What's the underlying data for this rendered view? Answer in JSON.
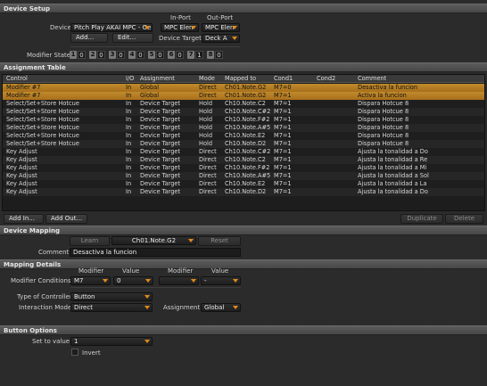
{
  "device_setup": {
    "header": "Device Setup",
    "device_label": "Device",
    "device_value": "Pitch Play AKAI MPC - Ge",
    "in_port_label": "In-Port",
    "in_port_value": "MPC Elen",
    "out_port_label": "Out-Port",
    "out_port_value": "MPC Elen",
    "add_label": "Add...",
    "edit_label": "Edit...",
    "device_target_label": "Device Target",
    "device_target_value": "Deck A",
    "modifier_state_label": "Modifier State",
    "modifier_states": [
      {
        "num": "1",
        "val": "0"
      },
      {
        "num": "2",
        "val": "0"
      },
      {
        "num": "3",
        "val": "0"
      },
      {
        "num": "4",
        "val": "0"
      },
      {
        "num": "5",
        "val": "0"
      },
      {
        "num": "6",
        "val": "0"
      },
      {
        "num": "7",
        "val": "1"
      },
      {
        "num": "8",
        "val": "0"
      }
    ]
  },
  "assignment_table": {
    "header": "Assignment Table",
    "columns": [
      "Control",
      "I/O",
      "Assignment",
      "Mode",
      "Mapped to",
      "Cond1",
      "Cond2",
      "Comment"
    ],
    "rows": [
      {
        "control": "Modifier #7",
        "io": "In",
        "assignment": "Global",
        "mode": "Direct",
        "mapped": "Ch01.Note.G2",
        "cond1": "M7=0",
        "cond2": "",
        "comment": "Desactiva la funcion",
        "selected": true
      },
      {
        "control": "Modifier #7",
        "io": "In",
        "assignment": "Global",
        "mode": "Direct",
        "mapped": "Ch01.Note.G2",
        "cond1": "M7=1",
        "cond2": "",
        "comment": "Activa la funcion",
        "selected": true
      },
      {
        "control": "Select/Set+Store Hotcue",
        "io": "In",
        "assignment": "Device Target",
        "mode": "Hold",
        "mapped": "Ch10.Note.C2",
        "cond1": "M7=1",
        "cond2": "",
        "comment": "Dispara Hotcue 8",
        "selected": false
      },
      {
        "control": "Select/Set+Store Hotcue",
        "io": "In",
        "assignment": "Device Target",
        "mode": "Hold",
        "mapped": "Ch10.Note.C#2",
        "cond1": "M7=1",
        "cond2": "",
        "comment": "Dispara Hotcue 8",
        "selected": false
      },
      {
        "control": "Select/Set+Store Hotcue",
        "io": "In",
        "assignment": "Device Target",
        "mode": "Hold",
        "mapped": "Ch10.Note.F#2",
        "cond1": "M7=1",
        "cond2": "",
        "comment": "Dispara Hotcue 8",
        "selected": false
      },
      {
        "control": "Select/Set+Store Hotcue",
        "io": "In",
        "assignment": "Device Target",
        "mode": "Hold",
        "mapped": "Ch10.Note.A#5",
        "cond1": "M7=1",
        "cond2": "",
        "comment": "Dispara Hotcue 8",
        "selected": false
      },
      {
        "control": "Select/Set+Store Hotcue",
        "io": "In",
        "assignment": "Device Target",
        "mode": "Hold",
        "mapped": "Ch10.Note.E2",
        "cond1": "M7=1",
        "cond2": "",
        "comment": "Dispara Hotcue 8",
        "selected": false
      },
      {
        "control": "Select/Set+Store Hotcue",
        "io": "In",
        "assignment": "Device Target",
        "mode": "Hold",
        "mapped": "Ch10.Note.D2",
        "cond1": "M7=1",
        "cond2": "",
        "comment": "Dispara Hotcue 8",
        "selected": false
      },
      {
        "control": "Key Adjust",
        "io": "In",
        "assignment": "Device Target",
        "mode": "Direct",
        "mapped": "Ch10.Note.C#2",
        "cond1": "M7=1",
        "cond2": "",
        "comment": "Ajusta la tonalidad a Do",
        "selected": false
      },
      {
        "control": "Key Adjust",
        "io": "In",
        "assignment": "Device Target",
        "mode": "Direct",
        "mapped": "Ch10.Note.C2",
        "cond1": "M7=1",
        "cond2": "",
        "comment": "Ajusta la tonalidad a Re",
        "selected": false
      },
      {
        "control": "Key Adjust",
        "io": "In",
        "assignment": "Device Target",
        "mode": "Direct",
        "mapped": "Ch10.Note.F#2",
        "cond1": "M7=1",
        "cond2": "",
        "comment": "Ajusta la tonalidad a Mi",
        "selected": false
      },
      {
        "control": "Key Adjust",
        "io": "In",
        "assignment": "Device Target",
        "mode": "Direct",
        "mapped": "Ch10.Note.A#5",
        "cond1": "M7=1",
        "cond2": "",
        "comment": "Ajusta la tonalidad a Sol",
        "selected": false
      },
      {
        "control": "Key Adjust",
        "io": "In",
        "assignment": "Device Target",
        "mode": "Direct",
        "mapped": "Ch10.Note.E2",
        "cond1": "M7=1",
        "cond2": "",
        "comment": "Ajusta la tonalidad a La",
        "selected": false
      },
      {
        "control": "Key Adjust",
        "io": "In",
        "assignment": "Device Target",
        "mode": "Direct",
        "mapped": "Ch10.Note.D2",
        "cond1": "M7=1",
        "cond2": "",
        "comment": "Ajusta la tonalidad a Do",
        "selected": false
      }
    ],
    "add_in_label": "Add In...",
    "add_out_label": "Add Out...",
    "duplicate_label": "Duplicate",
    "delete_label": "Delete"
  },
  "device_mapping": {
    "header": "Device Mapping",
    "learn_label": "Learn",
    "mapped_value": "Ch01.Note.G2",
    "reset_label": "Reset",
    "comment_label": "Comment",
    "comment_value": "Desactiva la funcion"
  },
  "mapping_details": {
    "header": "Mapping Details",
    "modifier_col1": "Modifier",
    "value_col1": "Value",
    "modifier_col2": "Modifier",
    "value_col2": "Value",
    "modifier_conditions_label": "Modifier Conditions",
    "cond1_modifier": "M7",
    "cond1_value": "0",
    "cond2_modifier": "",
    "cond2_value": "-",
    "type_of_controller_label": "Type of Controller",
    "type_of_controller_value": "Button",
    "interaction_mode_label": "Interaction Mode",
    "interaction_mode_value": "Direct",
    "assignment_label": "Assignment",
    "assignment_value": "Global"
  },
  "button_options": {
    "header": "Button Options",
    "set_to_value_label": "Set to value",
    "set_to_value_value": "1",
    "invert_label": "Invert"
  },
  "colors": {
    "accent": "#e08a1a",
    "selected_row": "#b87d24",
    "background": "#2b2b2b"
  }
}
